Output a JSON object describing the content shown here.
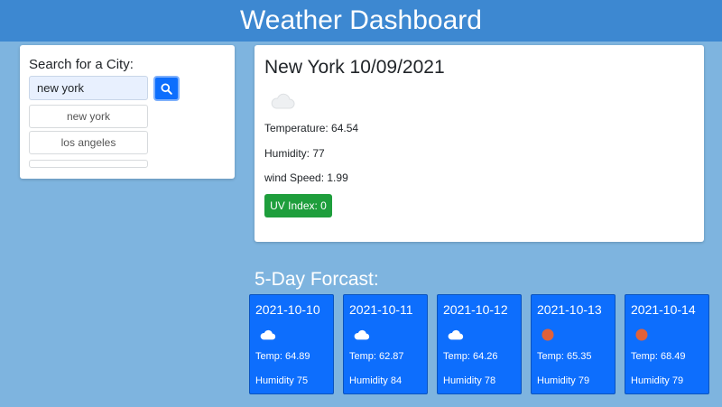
{
  "header": {
    "title": "Weather Dashboard"
  },
  "search": {
    "title": "Search for a City:",
    "value": "new york",
    "history": [
      "new york",
      "los angeles",
      ""
    ]
  },
  "current": {
    "title": "New York 10/09/2021",
    "icon": "cloud-icon",
    "temperature": "Temperature: 64.54",
    "humidity": "Humidity: 77",
    "wind": "wind Speed: 1.99",
    "uv": "UV Index: 0",
    "uv_color": "#1e9e3c"
  },
  "forecast": {
    "title": "5-Day Forcast:",
    "days": [
      {
        "date": "2021-10-10",
        "icon": "cloud-icon",
        "temp": "Temp: 64.89",
        "humidity": "Humidity 75"
      },
      {
        "date": "2021-10-11",
        "icon": "cloud-icon",
        "temp": "Temp: 62.87",
        "humidity": "Humidity 84"
      },
      {
        "date": "2021-10-12",
        "icon": "cloud-icon",
        "temp": "Temp: 64.26",
        "humidity": "Humidity 78"
      },
      {
        "date": "2021-10-13",
        "icon": "sun-icon",
        "temp": "Temp: 65.35",
        "humidity": "Humidity 79"
      },
      {
        "date": "2021-10-14",
        "icon": "sun-icon",
        "temp": "Temp: 68.49",
        "humidity": "Humidity 79"
      }
    ]
  },
  "colors": {
    "header": "#3d88d1",
    "background": "#7eb4df",
    "card": "#0d6efd",
    "sun": "#e0613a"
  }
}
